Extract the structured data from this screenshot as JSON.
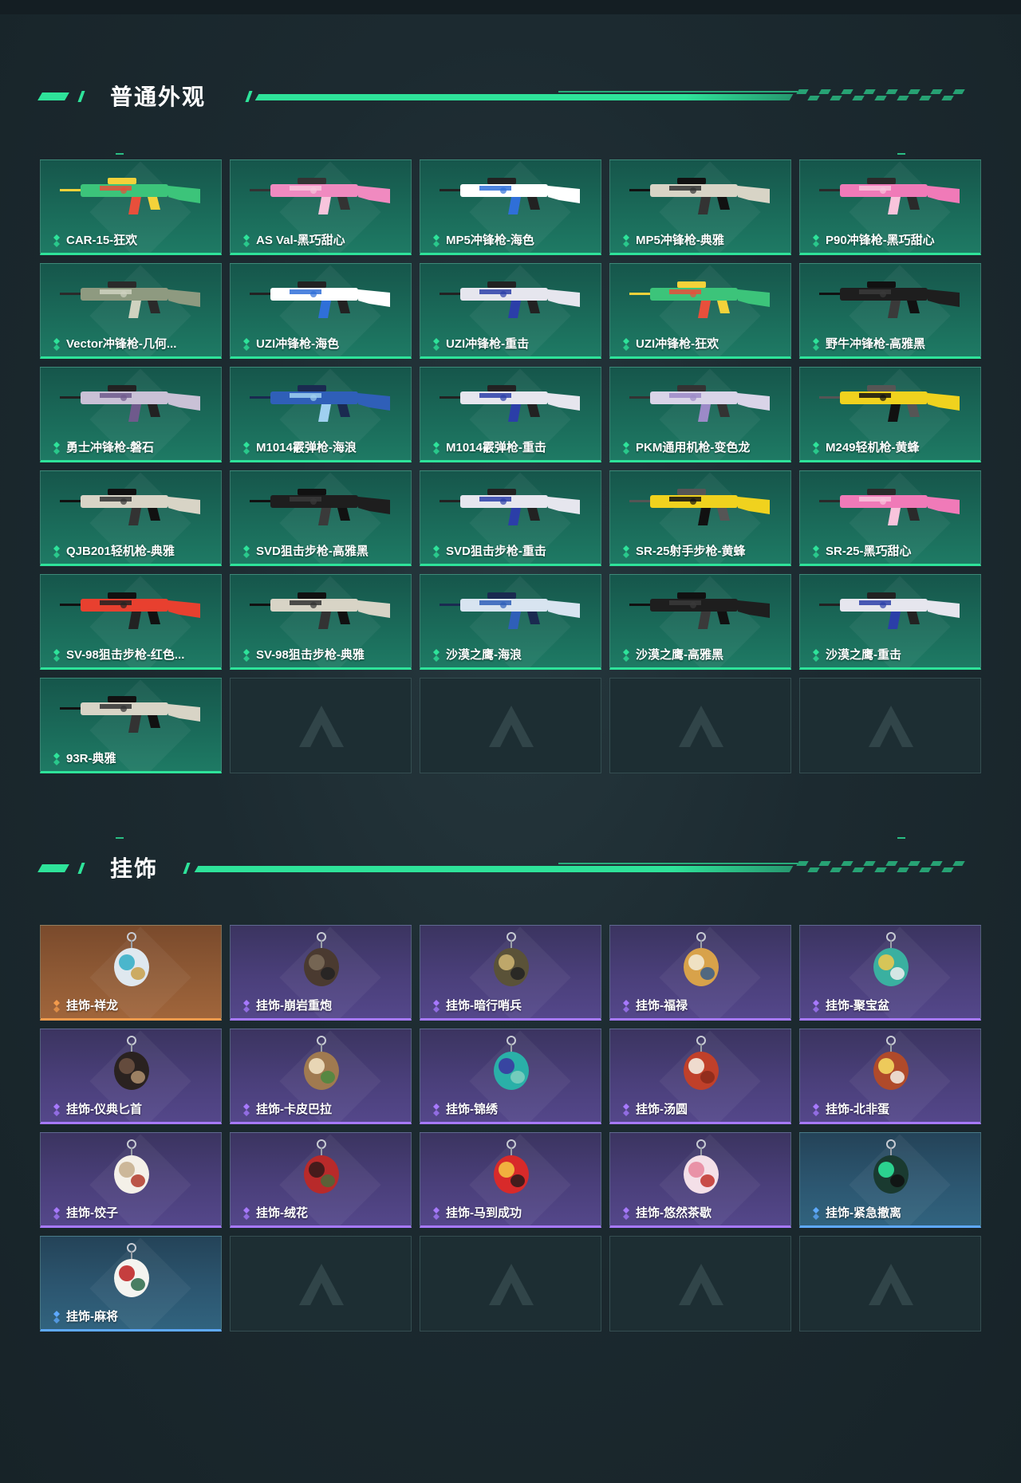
{
  "sections": {
    "skins": {
      "title": "普通外观",
      "items": [
        {
          "name": "CAR-15-狂欢",
          "rarity": "green",
          "colors": [
            "#3cc47a",
            "#e84f3b",
            "#f4d23a"
          ]
        },
        {
          "name": "AS Val-黑巧甜心",
          "rarity": "green",
          "colors": [
            "#f08ac0",
            "#f8c4dc",
            "#333333"
          ]
        },
        {
          "name": "MP5冲锋枪-海色",
          "rarity": "green",
          "colors": [
            "#ffffff",
            "#2f6fd8",
            "#222222"
          ]
        },
        {
          "name": "MP5冲锋枪-典雅",
          "rarity": "green",
          "colors": [
            "#d8d4c6",
            "#333333",
            "#111111"
          ]
        },
        {
          "name": "P90冲锋枪-黑巧甜心",
          "rarity": "green",
          "colors": [
            "#f07ab8",
            "#f8c4dc",
            "#2a2a2a"
          ]
        },
        {
          "name": "Vector冲锋枪-几何...",
          "rarity": "green",
          "colors": [
            "#8e9a80",
            "#cfd2c0",
            "#2a2a2a"
          ]
        },
        {
          "name": "UZI冲锋枪-海色",
          "rarity": "green",
          "colors": [
            "#ffffff",
            "#2f6fd8",
            "#222222"
          ]
        },
        {
          "name": "UZI冲锋枪-重击",
          "rarity": "green",
          "colors": [
            "#e6e6ee",
            "#2b3ea8",
            "#222222"
          ]
        },
        {
          "name": "UZI冲锋枪-狂欢",
          "rarity": "green",
          "colors": [
            "#3cc47a",
            "#e84f3b",
            "#f4d23a"
          ]
        },
        {
          "name": "野牛冲锋枪-高雅黑",
          "rarity": "green",
          "colors": [
            "#1e1e1e",
            "#3a3a3a",
            "#111111"
          ]
        },
        {
          "name": "勇士冲锋枪-磐石",
          "rarity": "green",
          "colors": [
            "#c9c1d6",
            "#6f5a8c",
            "#222222"
          ]
        },
        {
          "name": "M1014霰弹枪-海浪",
          "rarity": "green",
          "colors": [
            "#2f5fb8",
            "#9fd0f0",
            "#1a2a50"
          ]
        },
        {
          "name": "M1014霰弹枪-重击",
          "rarity": "green",
          "colors": [
            "#e6e6ee",
            "#2b3ea8",
            "#222222"
          ]
        },
        {
          "name": "PKM通用机枪-变色龙",
          "rarity": "green",
          "colors": [
            "#d9d4e8",
            "#9c8ac8",
            "#333333"
          ]
        },
        {
          "name": "M249轻机枪-黄蜂",
          "rarity": "green",
          "colors": [
            "#f0d21e",
            "#111111",
            "#555555"
          ]
        },
        {
          "name": "QJB201轻机枪-典雅",
          "rarity": "green",
          "colors": [
            "#d8d4c6",
            "#333333",
            "#111111"
          ]
        },
        {
          "name": "SVD狙击步枪-高雅黑",
          "rarity": "green",
          "colors": [
            "#1e1e1e",
            "#3a3a3a",
            "#111111"
          ]
        },
        {
          "name": "SVD狙击步枪-重击",
          "rarity": "green",
          "colors": [
            "#e6e6ee",
            "#2b3ea8",
            "#222222"
          ]
        },
        {
          "name": "SR-25射手步枪-黄蜂",
          "rarity": "green",
          "colors": [
            "#f0d21e",
            "#111111",
            "#555555"
          ]
        },
        {
          "name": "SR-25-黑巧甜心",
          "rarity": "green",
          "colors": [
            "#f07ab8",
            "#f8c4dc",
            "#2a2a2a"
          ]
        },
        {
          "name": "SV-98狙击步枪-红色...",
          "rarity": "green",
          "colors": [
            "#e8402f",
            "#222222",
            "#111111"
          ]
        },
        {
          "name": "SV-98狙击步枪-典雅",
          "rarity": "green",
          "colors": [
            "#d8d4c6",
            "#333333",
            "#111111"
          ]
        },
        {
          "name": "沙漠之鹰-海浪",
          "rarity": "green",
          "colors": [
            "#d8e4f0",
            "#2f5fb8",
            "#1a2a50"
          ]
        },
        {
          "name": "沙漠之鹰-高雅黑",
          "rarity": "green",
          "colors": [
            "#1e1e1e",
            "#3a3a3a",
            "#111111"
          ]
        },
        {
          "name": "沙漠之鹰-重击",
          "rarity": "green",
          "colors": [
            "#e6e6ee",
            "#2b3ea8",
            "#222222"
          ]
        },
        {
          "name": "93R-典雅",
          "rarity": "green",
          "colors": [
            "#d8d4c6",
            "#333333",
            "#111111"
          ]
        }
      ],
      "empty_slots": 4
    },
    "charms": {
      "title": "挂饰",
      "items": [
        {
          "name": "挂饰-祥龙",
          "rarity": "orange",
          "colors": [
            "#dfe8ef",
            "#3ab0c8",
            "#c9a04a"
          ]
        },
        {
          "name": "挂饰-崩岩重炮",
          "rarity": "purple",
          "colors": [
            "#4a3a30",
            "#7a6a58",
            "#222222"
          ]
        },
        {
          "name": "挂饰-暗行哨兵",
          "rarity": "purple",
          "colors": [
            "#5a5238",
            "#c9b070",
            "#222222"
          ]
        },
        {
          "name": "挂饰-福禄",
          "rarity": "purple",
          "colors": [
            "#d8a24a",
            "#f2e8d0",
            "#3a5e8a"
          ]
        },
        {
          "name": "挂饰-聚宝盆",
          "rarity": "purple",
          "colors": [
            "#3ab0a0",
            "#e8c850",
            "#f0f0f0"
          ]
        },
        {
          "name": "挂饰-仪典匕首",
          "rarity": "purple",
          "colors": [
            "#2a2220",
            "#6a5040",
            "#b09070"
          ]
        },
        {
          "name": "挂饰-卡皮巴拉",
          "rarity": "purple",
          "colors": [
            "#a07a50",
            "#f0e0c0",
            "#4a8a40"
          ]
        },
        {
          "name": "挂饰-锦绣",
          "rarity": "purple",
          "colors": [
            "#2ab0a8",
            "#3a3aa0",
            "#80d0c0"
          ]
        },
        {
          "name": "挂饰-汤圆",
          "rarity": "purple",
          "colors": [
            "#c0402a",
            "#f4ece0",
            "#8a2a1a"
          ]
        },
        {
          "name": "挂饰-北非蛋",
          "rarity": "purple",
          "colors": [
            "#b04a2a",
            "#f4d860",
            "#f4f0e8"
          ]
        },
        {
          "name": "挂饰-饺子",
          "rarity": "purple",
          "colors": [
            "#f4f0e8",
            "#c8b090",
            "#b03a2a"
          ]
        },
        {
          "name": "挂饰-绒花",
          "rarity": "purple",
          "colors": [
            "#b82a2a",
            "#3a1a1a",
            "#4a6a3a"
          ]
        },
        {
          "name": "挂饰-马到成功",
          "rarity": "purple",
          "colors": [
            "#d82a2a",
            "#f4c040",
            "#2a1a1a"
          ]
        },
        {
          "name": "挂饰-悠然茶歇",
          "rarity": "purple",
          "colors": [
            "#f4e0e8",
            "#e88aa0",
            "#c0302a"
          ]
        },
        {
          "name": "挂饰-紧急撤离",
          "rarity": "blue",
          "colors": [
            "#1a3a30",
            "#2ee39a",
            "#111111"
          ]
        },
        {
          "name": "挂饰-麻将",
          "rarity": "blue",
          "colors": [
            "#f4f4f0",
            "#c02a2a",
            "#2a6a4a"
          ]
        }
      ],
      "empty_slots": 4
    }
  },
  "rarity_colors": {
    "green": "#2ee39a",
    "purple": "#a779ff",
    "orange": "#f39b4c",
    "blue": "#5ea9ff"
  },
  "empty_slot_icon": "a-logo-watermark-icon"
}
